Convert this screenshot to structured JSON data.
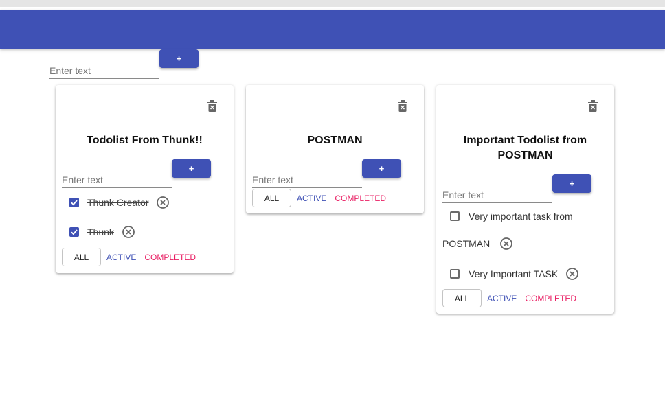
{
  "header": {
    "title": ""
  },
  "top_form": {
    "placeholder": "Enter text",
    "add_label": "+"
  },
  "lists": [
    {
      "title": "Todolist From Thunk!!",
      "input_placeholder": "Enter text",
      "add_label": "+",
      "tasks": [
        {
          "text": "Thunk Creator",
          "done": true
        },
        {
          "text": "Thunk",
          "done": true
        }
      ],
      "filters": {
        "all": "ALL",
        "active": "ACTIVE",
        "completed": "COMPLETED"
      }
    },
    {
      "title": "POSTMAN",
      "input_placeholder": "Enter text",
      "add_label": "+",
      "tasks": [],
      "filters": {
        "all": "ALL",
        "active": "ACTIVE",
        "completed": "COMPLETED"
      }
    },
    {
      "title_line1": "Important Todolist from",
      "title_line2": "POSTMAN",
      "input_placeholder": "Enter text",
      "add_label": "+",
      "tasks": [
        {
          "text_line1": "Very important task from",
          "text_line2": "POSTMAN",
          "done": false
        },
        {
          "text": "Very Important TASK",
          "done": false
        }
      ],
      "filters": {
        "all": "ALL",
        "active": "ACTIVE",
        "completed": "COMPLETED"
      }
    }
  ],
  "colors": {
    "primary": "#3f51b5",
    "secondary": "#e91e63"
  },
  "icons": {
    "delete_list": "trash-icon",
    "remove_task": "close-circle-icon",
    "checkbox": "checkbox-icon"
  }
}
